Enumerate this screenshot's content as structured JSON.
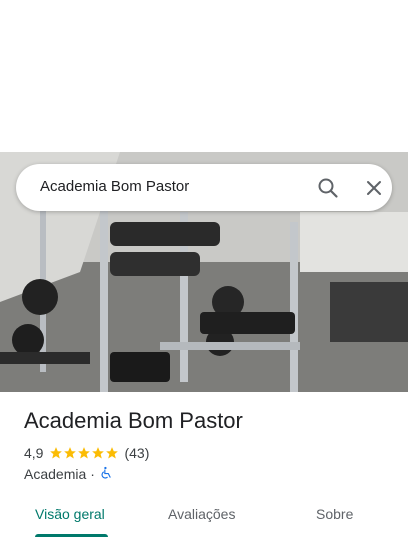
{
  "search": {
    "query": "Academia Bom Pastor"
  },
  "place": {
    "name": "Academia Bom Pastor",
    "rating": "4,9",
    "stars": 5,
    "review_count": "(43)",
    "category": "Academia",
    "separator": "·"
  },
  "tabs": [
    {
      "label": "Visão geral",
      "active": true
    },
    {
      "label": "Avaliações",
      "active": false
    },
    {
      "label": "Sobre",
      "active": false
    }
  ],
  "colors": {
    "accent": "#00796b",
    "star": "#fbbc04",
    "accessibility": "#1a73e8"
  },
  "icons": {
    "search": "search-icon",
    "close": "close-icon",
    "accessibility": "wheelchair-icon"
  }
}
